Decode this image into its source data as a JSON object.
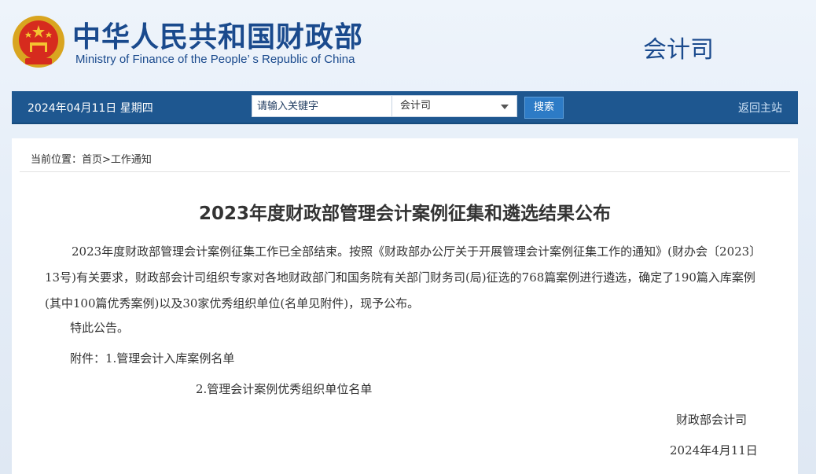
{
  "header": {
    "title_cn": "中华人民共和国财政部",
    "title_en": "Ministry of Finance of the People’ s Republic of China",
    "department": "会计司"
  },
  "nav": {
    "date": "2024年04月11日  星期四",
    "search_placeholder": "请输入关键字",
    "select_value": "会计司",
    "search_button": "搜索",
    "home_link": "返回主站"
  },
  "breadcrumb": "当前位置：首页>工作通知",
  "article": {
    "title": "2023年度财政部管理会计案例征集和遴选结果公布",
    "paragraph": "2023年度财政部管理会计案例征集工作已全部结束。按照《财政部办公厅关于开展管理会计案例征集工作的通知》(财办会〔2023〕13号)有关要求，财政部会计司组织专家对各地财政部门和国务院有关部门财务司(局)征选的768篇案例进行遴选，确定了190篇入库案例(其中100篇优秀案例)以及30家优秀组织单位(名单见附件)，现予公布。",
    "notice": "特此公告。",
    "attachment_1": "附件：1.管理会计入库案例名单",
    "attachment_2": "2.管理会计案例优秀组织单位名单",
    "signature": "财政部会计司",
    "date": "2024年4月11日"
  },
  "colors": {
    "brand_blue": "#1a4a8d",
    "nav_bg": "#1e5790",
    "button_bg": "#2d7bc6"
  }
}
